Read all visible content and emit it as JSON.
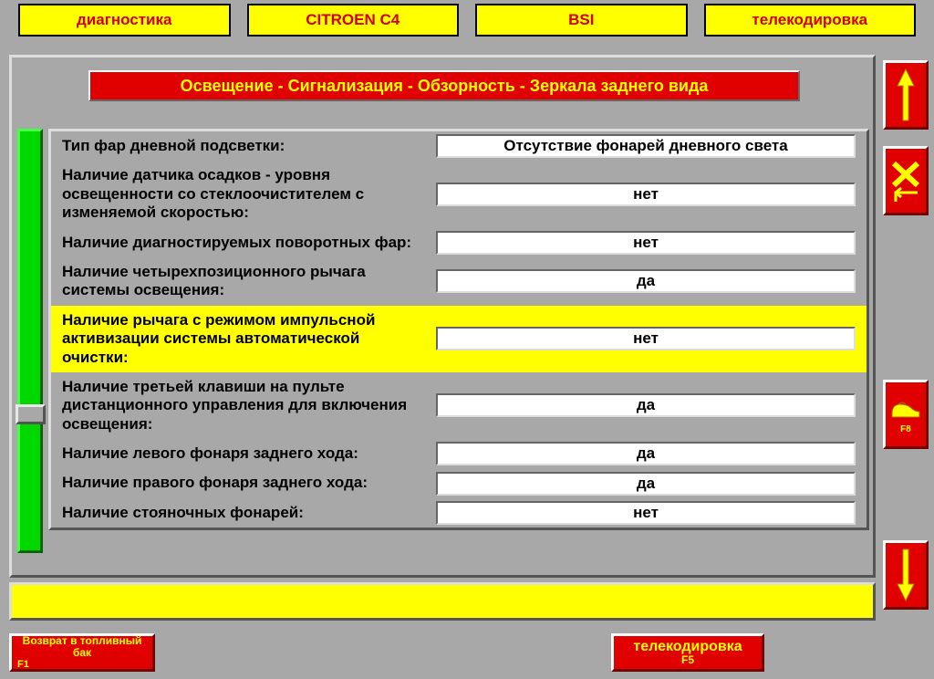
{
  "top": {
    "b1": "диагностика",
    "b2": "CITROEN C4",
    "b3": "BSI",
    "b4": "телекодировка"
  },
  "section_title": "Освещение - Сигнализация - Обзорность - Зеркала заднего вида",
  "params": [
    {
      "label": "Тип фар дневной подсветки:",
      "value": "Отсутствие фонарей дневного света",
      "selected": false
    },
    {
      "label": "Наличие датчика осадков - уровня освещенности со стеклоочистителем с изменяемой скоростью:",
      "value": "нет",
      "selected": false
    },
    {
      "label": "Наличие диагностируемых поворотных фар:",
      "value": "нет",
      "selected": false
    },
    {
      "label": "Наличие четырехпозиционного рычага системы освещения:",
      "value": "да",
      "selected": false
    },
    {
      "label": "Наличие рычага с режимом импульсной активизации системы автоматической очистки:",
      "value": "нет",
      "selected": true
    },
    {
      "label": "Наличие третьей клавиши на пульте дистанционного управления для включения освещения:",
      "value": "да",
      "selected": false
    },
    {
      "label": "Наличие левого фонаря заднего хода:",
      "value": "да",
      "selected": false
    },
    {
      "label": "Наличие правого фонаря заднего хода:",
      "value": "да",
      "selected": false
    },
    {
      "label": "Наличие стояночных фонарей:",
      "value": "нет",
      "selected": false
    }
  ],
  "side": {
    "f8": "F8"
  },
  "bottom": {
    "f1_line1": "Возврат в топливный",
    "f1_line2": "бак",
    "f1_key": "F1",
    "f5_label": "телекодировка",
    "f5_key": "F5"
  }
}
